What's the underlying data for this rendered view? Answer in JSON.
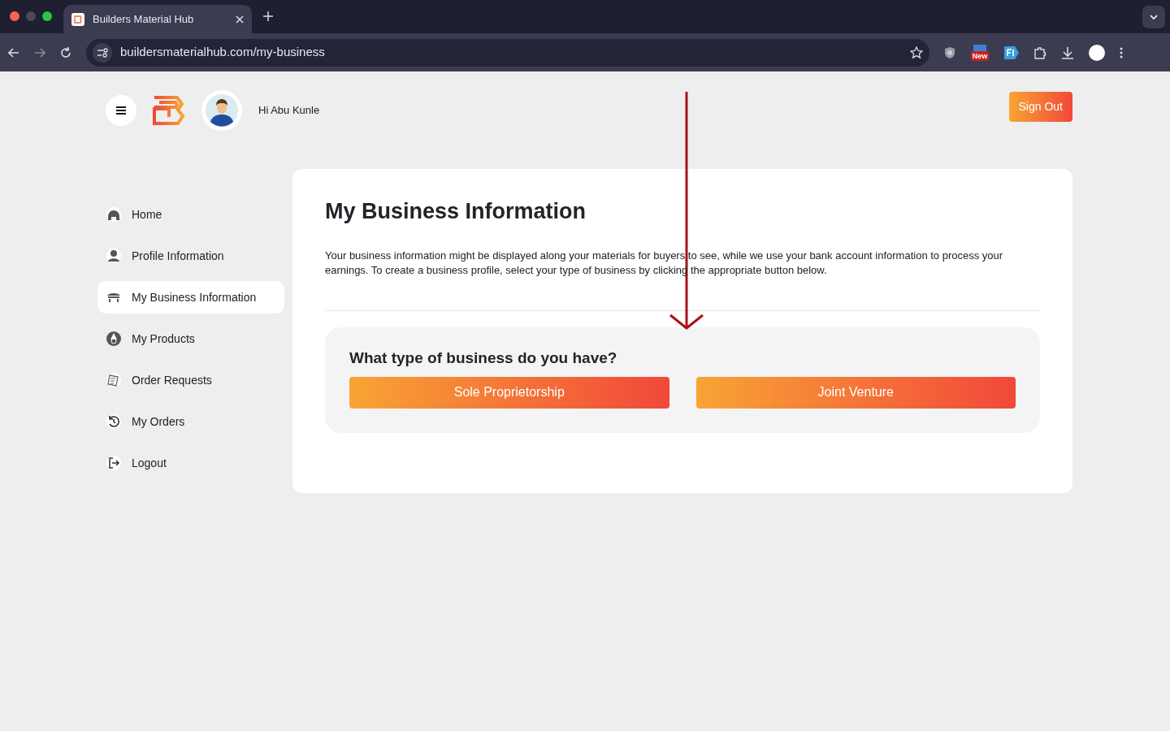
{
  "browser": {
    "tab_title": "Builders Material Hub",
    "url": "buildersmaterialhub.com/my-business",
    "extension_badge": "New"
  },
  "header": {
    "greeting": "Hi Abu Kunle",
    "sign_out": "Sign Out"
  },
  "sidebar": {
    "items": [
      {
        "label": "Home",
        "kind": "home",
        "selected": false
      },
      {
        "label": "Profile Information",
        "kind": "person",
        "selected": false
      },
      {
        "label": "My Business Information",
        "kind": "shop",
        "selected": true
      },
      {
        "label": "My Products",
        "kind": "products",
        "selected": false
      },
      {
        "label": "Order Requests",
        "kind": "requests",
        "selected": false
      },
      {
        "label": "My Orders",
        "kind": "history",
        "selected": false
      },
      {
        "label": "Logout",
        "kind": "logout",
        "selected": false
      }
    ]
  },
  "main": {
    "title": "My Business Information",
    "description": "Your business information might be displayed along your materials for buyers to see, while we use your bank account information to process your earnings. To create a business profile, select your type of business by clicking the appropriate button below.",
    "question": "What type of business do you have?",
    "buttons": [
      "Sole Proprietorship",
      "Joint Venture"
    ]
  }
}
